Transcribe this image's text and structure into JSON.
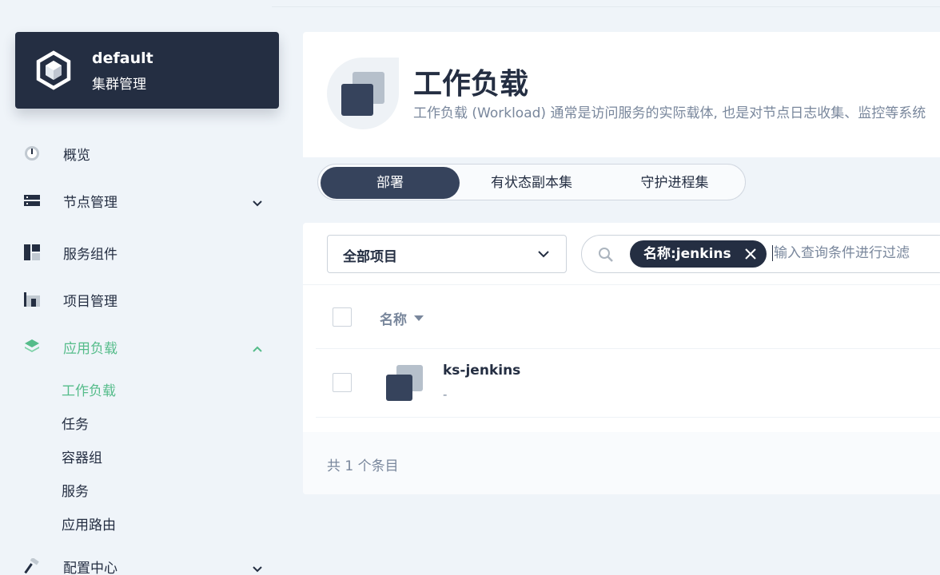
{
  "cluster": {
    "name": "default",
    "subtitle": "集群管理"
  },
  "sidebar": {
    "items": [
      {
        "label": "概览"
      },
      {
        "label": "节点管理"
      },
      {
        "label": "服务组件"
      },
      {
        "label": "项目管理"
      },
      {
        "label": "应用负载"
      },
      {
        "label": "配置中心"
      }
    ],
    "workload_sub": [
      {
        "label": "工作负载"
      },
      {
        "label": "任务"
      },
      {
        "label": "容器组"
      },
      {
        "label": "服务"
      },
      {
        "label": "应用路由"
      }
    ],
    "active_color": "#55bc8a"
  },
  "header": {
    "title": "工作负载",
    "description": "工作负载 (Workload) 通常是访问服务的实际载体, 也是对节点日志收集、监控等系统"
  },
  "tabs": [
    {
      "label": "部署"
    },
    {
      "label": "有状态副本集"
    },
    {
      "label": "守护进程集"
    }
  ],
  "toolbar": {
    "project_select": "全部项目",
    "filter_tag": "名称:jenkins",
    "search_placeholder": "输入查询条件进行过滤"
  },
  "table": {
    "columns": [
      {
        "label": "名称"
      }
    ],
    "rows": [
      {
        "name": "ks-jenkins",
        "description": "-"
      }
    ]
  },
  "footer": {
    "total": "共 1 个条目"
  }
}
